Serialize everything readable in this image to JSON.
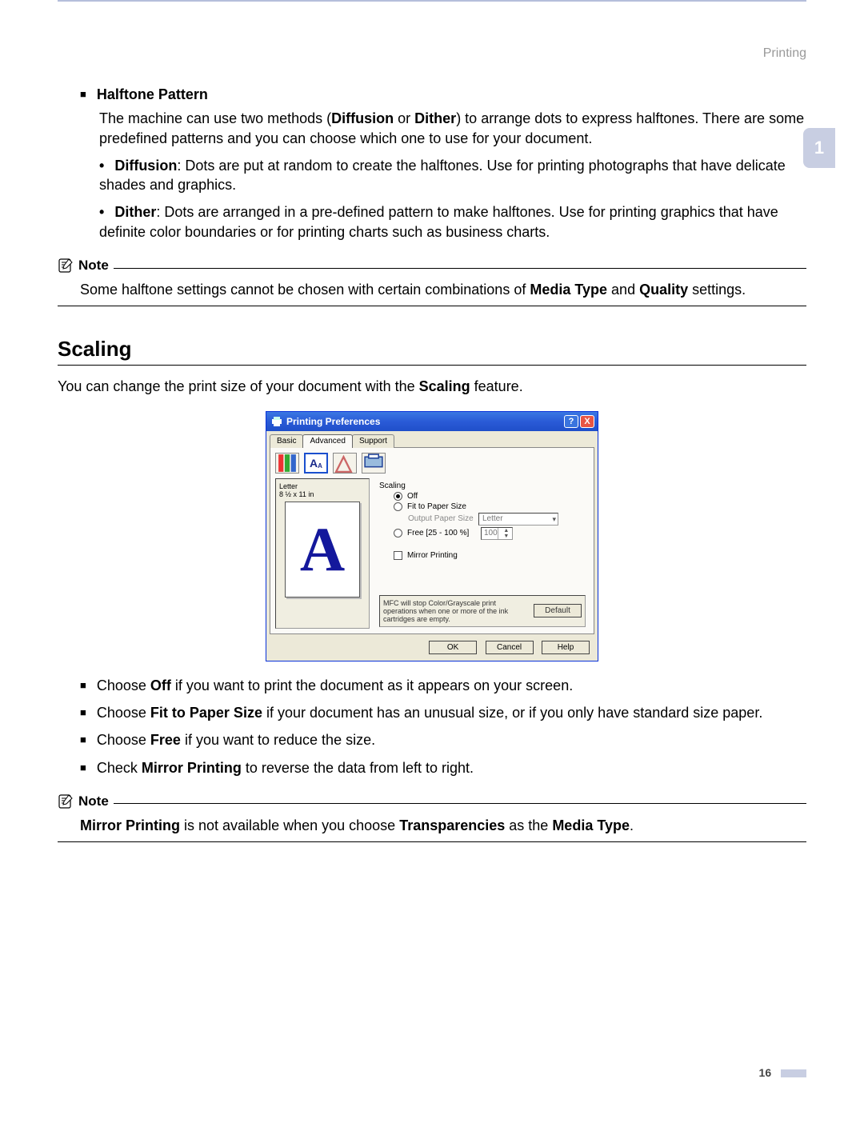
{
  "page_header": "Printing",
  "chapter_number": "1",
  "page_number": "16",
  "halftone": {
    "heading": "Halftone Pattern",
    "intro_1": "The machine can use two methods (",
    "intro_b1": "Diffusion",
    "intro_2": " or ",
    "intro_b2": "Dither",
    "intro_3": ") to arrange dots to express halftones. There are some predefined patterns and you can choose which one to use for your document.",
    "diffusion_b": "Diffusion",
    "diffusion_t": ": Dots are put at random to create the halftones. Use for printing photographs that have delicate shades and graphics.",
    "dither_b": "Dither",
    "dither_t": ": Dots are arranged in a pre-defined pattern to make halftones. Use for printing graphics that have definite color boundaries or for printing charts such as business charts."
  },
  "note1": {
    "title": "Note",
    "t1": "Some halftone settings cannot be chosen with certain combinations of ",
    "b1": "Media Type",
    "t2": " and ",
    "b2": "Quality",
    "t3": " settings."
  },
  "scaling": {
    "heading": "Scaling",
    "intro_1": "You can change the print size of your document with the ",
    "intro_b1": "Scaling",
    "intro_2": " feature."
  },
  "dialog": {
    "title": "Printing Preferences",
    "tabs": {
      "basic": "Basic",
      "advanced": "Advanced",
      "support": "Support"
    },
    "preview": {
      "size_label_1": "Letter",
      "size_label_2": "8 ½ x 11 in"
    },
    "group_label": "Scaling",
    "options": {
      "off": "Off",
      "fit": "Fit to Paper Size",
      "output_label": "Output Paper Size",
      "output_value": "Letter",
      "free": "Free [25 - 100 %]",
      "free_value": "100",
      "mirror": "Mirror Printing"
    },
    "warning": "MFC will stop Color/Grayscale print operations when one or more of the ink cartridges are empty.",
    "buttons": {
      "default": "Default",
      "ok": "OK",
      "cancel": "Cancel",
      "help": "Help"
    }
  },
  "choices": {
    "off_1": "Choose ",
    "off_b": "Off",
    "off_2": " if you want to print the document as it appears on your screen.",
    "fit_1": "Choose ",
    "fit_b": "Fit to Paper Size",
    "fit_2": " if your document has an unusual size, or if you only have standard size paper.",
    "free_1": "Choose ",
    "free_b": "Free",
    "free_2": " if you want to reduce the size.",
    "mir_1": "Check ",
    "mir_b": "Mirror Printing",
    "mir_2": " to reverse the data from left to right."
  },
  "note2": {
    "title": "Note",
    "b1": "Mirror Printing",
    "t1": " is not available when you choose ",
    "b2": "Transparencies",
    "t2": " as the ",
    "b3": "Media Type",
    "t3": "."
  }
}
